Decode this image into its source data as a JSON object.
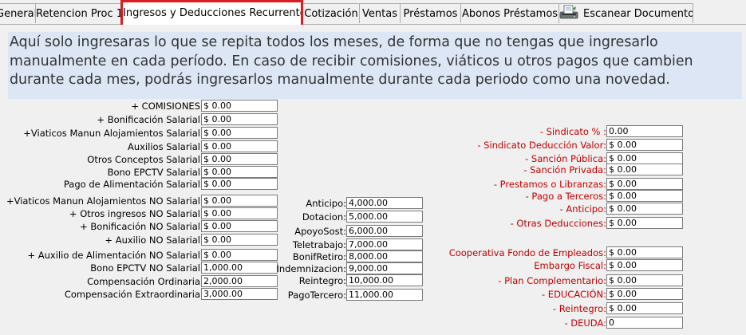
{
  "tabs": [
    {
      "label": "General"
    },
    {
      "label": "Retencion Proc 1"
    },
    {
      "label": "Ingresos y Deducciones Recurrentes"
    },
    {
      "label": "Cotización"
    },
    {
      "label": "Ventas"
    },
    {
      "label": "Préstamos"
    },
    {
      "label": "Abonos Préstamos"
    },
    {
      "label": "Escanear Documentos",
      "icon": "scanner-icon"
    }
  ],
  "notice": "Aquí solo ingresaras lo que se repita todos los meses, de forma que no tengas que ingresarlo manualmente en cada período. En caso de recibir comisiones, viáticos u otros pagos que cambien durante cada mes, podrás ingresarlos manualmente durante cada periodo como una novedad.",
  "salarial": [
    {
      "label": "+ COMISIONES",
      "value": "$ 0.00"
    },
    {
      "label": "+ Bonificación Salarial",
      "value": "$ 0.00"
    },
    {
      "label": "+Viaticos Manun Alojamientos Salarial",
      "value": "$ 0.00"
    },
    {
      "label": "Auxilios Salarial",
      "value": "$ 0.00"
    },
    {
      "label": "Otros Conceptos Salarial",
      "value": "$ 0.00"
    },
    {
      "label": "Bono EPCTV Salarial",
      "value": "$ 0.00"
    },
    {
      "label": "Pago de Alimentación Salarial",
      "value": "$ 0.00"
    }
  ],
  "no_salarial": [
    {
      "label": "+Viaticos Manun Alojamientos NO Salarial",
      "value": "$ 0.00"
    },
    {
      "label": "+ Otros ingresos NO Salarial",
      "value": "$ 0.00"
    },
    {
      "label": "+ Bonificación NO Salarial",
      "value": "$ 0.00"
    },
    {
      "label": "+ Auxilio NO Salarial",
      "value": "$ 0.00"
    },
    {
      "label": "+ Auxilio de Alimentación NO Salarial",
      "value": "$ 0.00"
    },
    {
      "label": "Bono EPCTV NO Salarial",
      "value": "1,000.00"
    },
    {
      "label": "Compensación Ordinaria",
      "value": "2,000.00"
    },
    {
      "label": "Compensación Extraordinaria",
      "value": "3,000.00"
    }
  ],
  "middle": [
    {
      "label": "Anticipo",
      "value": "4,000.00"
    },
    {
      "label": "Dotacion",
      "value": "5,000.00"
    },
    {
      "label": "ApoyoSost",
      "value": "6,000.00"
    },
    {
      "label": "Teletrabajo",
      "value": "7,000.00"
    },
    {
      "label": "BonifRetiro",
      "value": "8,000.00"
    },
    {
      "label": "Indemnizacion",
      "value": "9,000.00"
    },
    {
      "label": "Reintegro",
      "value": "10,000.00"
    },
    {
      "label": "PagoTercero",
      "value": "11,000.00"
    }
  ],
  "deducciones": [
    {
      "label": "- Sindicato % :",
      "value": "0.00"
    },
    {
      "label": "- Sindicato Deducción Valor:",
      "value": "$ 0.00"
    },
    {
      "label": "- Sanción Pública:",
      "value": "$ 0.00"
    },
    {
      "label": "- Sanción Privada:",
      "value": "$ 0.00"
    },
    {
      "label": "- Prestamos o Libranzas:",
      "value": "$ 0.00"
    },
    {
      "label": "- Pago a Terceros:",
      "value": "$ 0.00"
    },
    {
      "label": "- Anticipo:",
      "value": "$ 0.00"
    },
    {
      "label": "- Otras Deducciones:",
      "value": "$ 0.00"
    }
  ],
  "otras": [
    {
      "label": "Cooperativa Fondo de Empleados:",
      "value": "$ 0.00"
    },
    {
      "label": "Embargo Fiscal:",
      "value": "$ 0.00"
    },
    {
      "label": "- Plan Complementario:",
      "value": "$ 0.00"
    },
    {
      "label": "- EDUCACIÓN:",
      "value": "$ 0.00"
    },
    {
      "label": "- Reintegro:",
      "value": "$ 0.00"
    },
    {
      "label": "- DEUDA:",
      "value": "0"
    }
  ],
  "colors": {
    "accent": "#d81e1e",
    "label_red": "#c00000",
    "notice_bg": "#dde6f4"
  }
}
